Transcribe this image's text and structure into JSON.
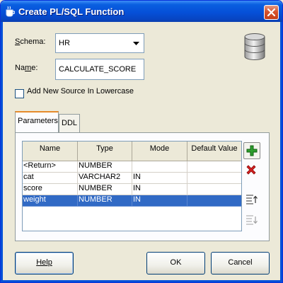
{
  "window": {
    "title": "Create PL/SQL Function"
  },
  "form": {
    "schema_label_accel": "S",
    "schema_label_rest": "chema:",
    "schema_value": "HR",
    "name_label_pre": "Na",
    "name_label_accel": "m",
    "name_label_post": "e:",
    "name_value": "CALCULATE_SCORE",
    "lowercase_label": "Add New Source In Lowercase",
    "lowercase_checked": false
  },
  "tabs": [
    {
      "label": "Parameters",
      "active": true
    },
    {
      "label": "DDL",
      "active": false
    }
  ],
  "grid": {
    "columns": [
      "Name",
      "Type",
      "Mode",
      "Default Value"
    ],
    "rows": [
      {
        "name": "<Return>",
        "type": "NUMBER",
        "mode": "",
        "default": "",
        "selected": false
      },
      {
        "name": "cat",
        "type": "VARCHAR2",
        "mode": "IN",
        "default": "",
        "selected": false
      },
      {
        "name": "score",
        "type": "NUMBER",
        "mode": "IN",
        "default": "",
        "selected": false
      },
      {
        "name": "weight",
        "type": "NUMBER",
        "mode": "IN",
        "default": "",
        "selected": true
      }
    ]
  },
  "side_buttons": [
    {
      "icon": "add-icon",
      "color": "#2e9e2e"
    },
    {
      "icon": "remove-icon",
      "color": "#d42020"
    },
    {
      "icon": "move-up-icon"
    },
    {
      "icon": "move-down-icon"
    }
  ],
  "buttons": {
    "help": "Help",
    "ok": "OK",
    "cancel": "Cancel"
  },
  "colors": {
    "titlebar": "#0550d8",
    "selection": "#316ac5",
    "tab_active_accent": "#e68b2c"
  }
}
